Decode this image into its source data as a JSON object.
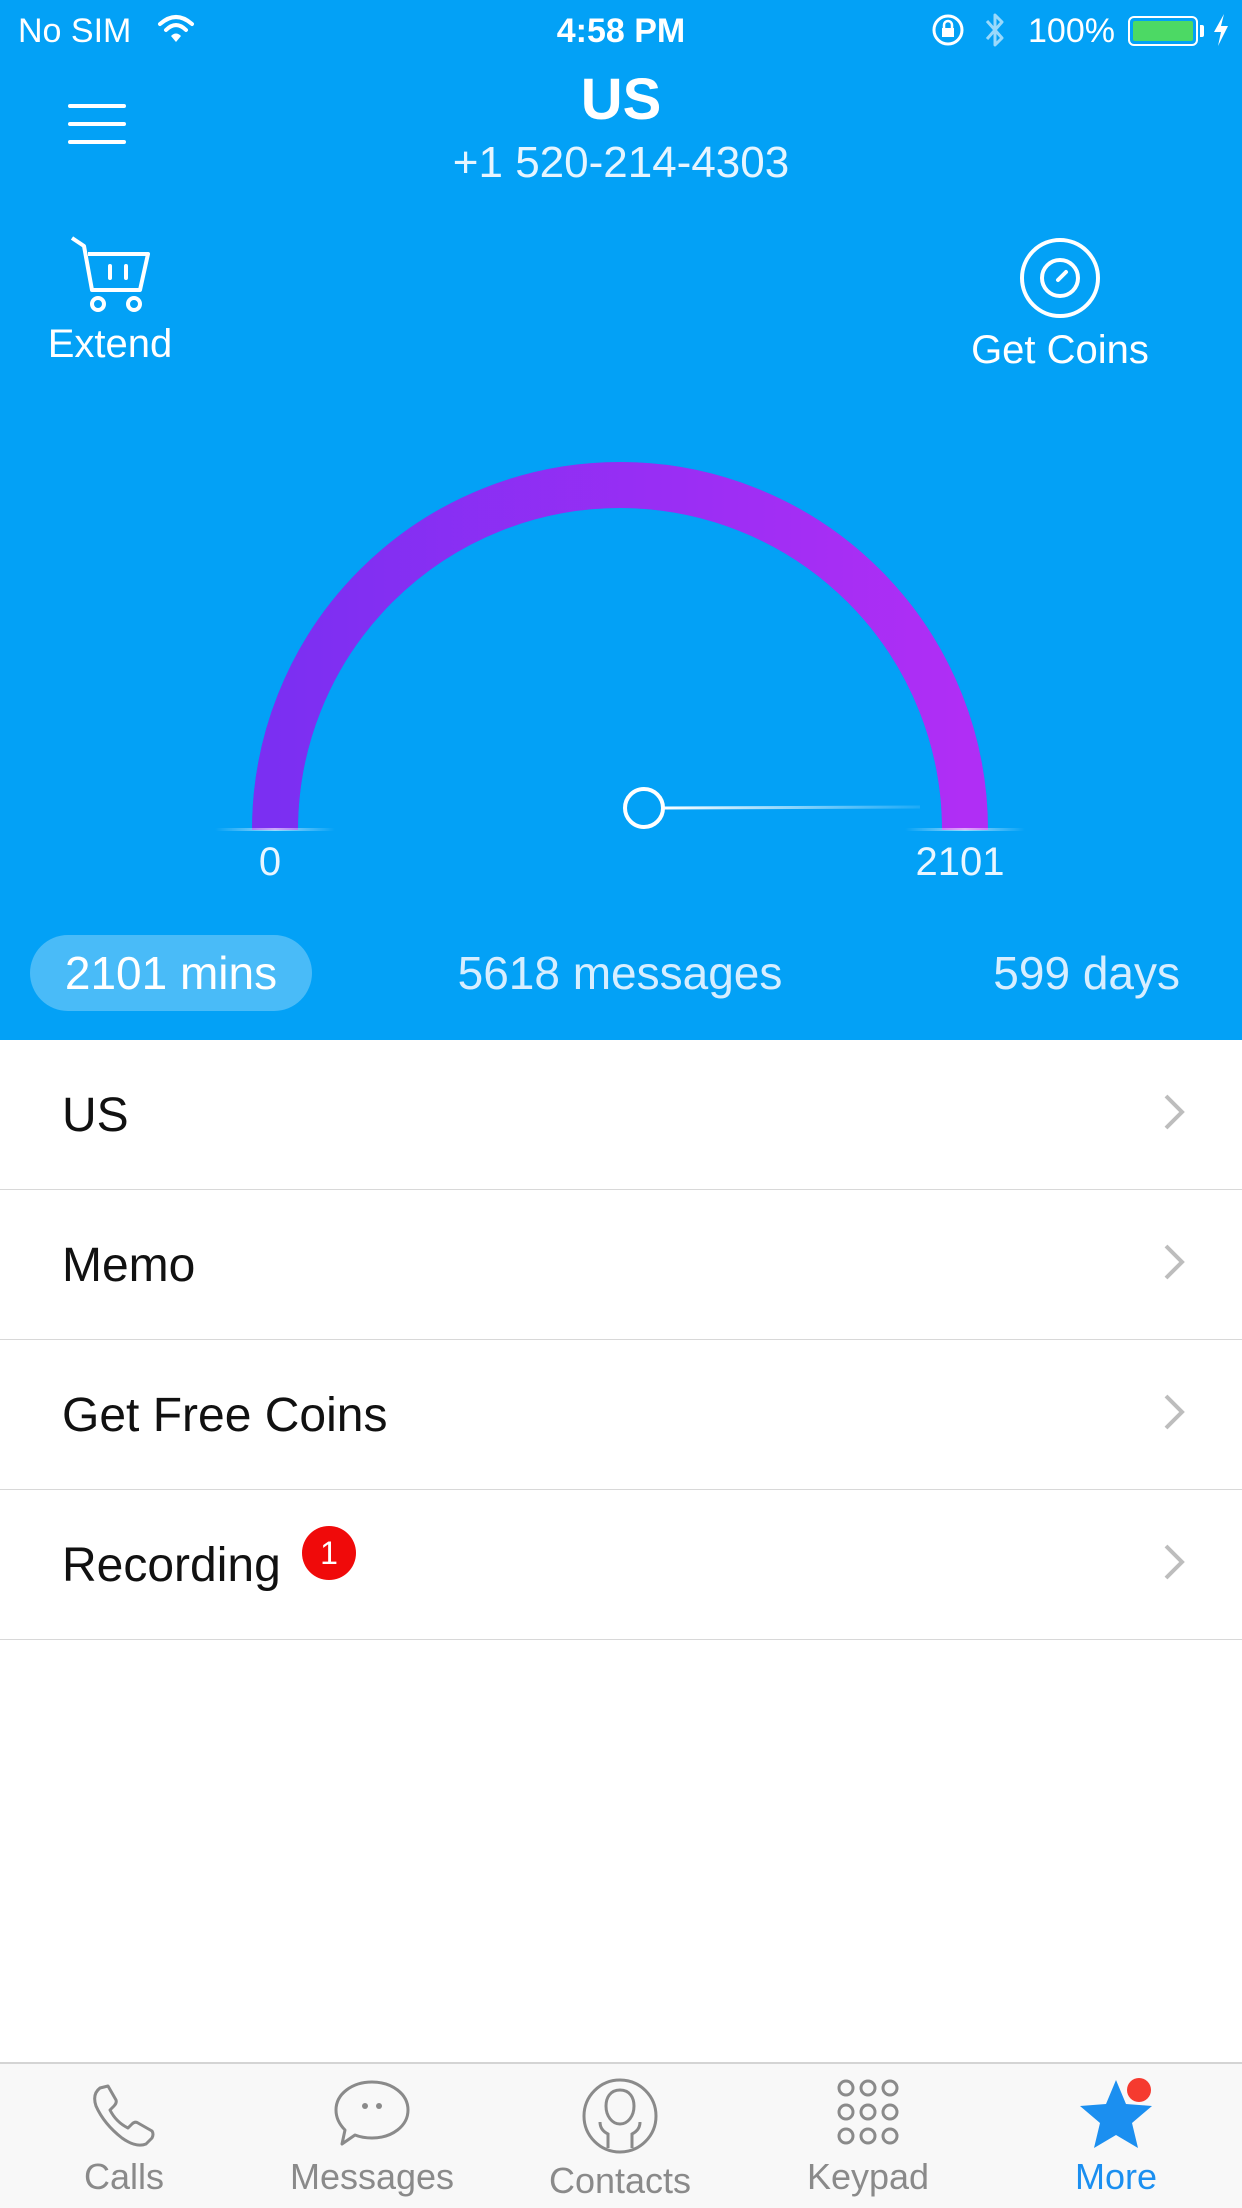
{
  "status_bar": {
    "carrier": "No SIM",
    "time": "4:58 PM",
    "battery_percent": "100%",
    "battery_level": 1.0
  },
  "header": {
    "title": "US",
    "phone_number": "+1 520-214-4303"
  },
  "actions": {
    "extend_label": "Extend",
    "get_coins_label": "Get Coins"
  },
  "gauge": {
    "min_label": "0",
    "max_label": "2101",
    "value": 2101,
    "max": 2101,
    "arc_color_start": "#7b2ff2",
    "arc_color_end": "#b02ef5"
  },
  "stats": {
    "minutes": "2101 mins",
    "messages": "5618 messages",
    "days": "599 days"
  },
  "list": {
    "items": [
      {
        "label": "US"
      },
      {
        "label": "Memo"
      },
      {
        "label": "Get Free Coins"
      },
      {
        "label": "Recording",
        "badge": "1"
      }
    ]
  },
  "tabbar": {
    "tabs": [
      {
        "label": "Calls",
        "icon": "phone-icon"
      },
      {
        "label": "Messages",
        "icon": "chat-bubble-icon"
      },
      {
        "label": "Contacts",
        "icon": "contact-icon"
      },
      {
        "label": "Keypad",
        "icon": "keypad-icon"
      },
      {
        "label": "More",
        "icon": "star-icon",
        "active": true
      }
    ]
  },
  "colors": {
    "header_bg": "#03a1f6",
    "accent": "#1b8ff0",
    "badge": "#f00a0a"
  }
}
